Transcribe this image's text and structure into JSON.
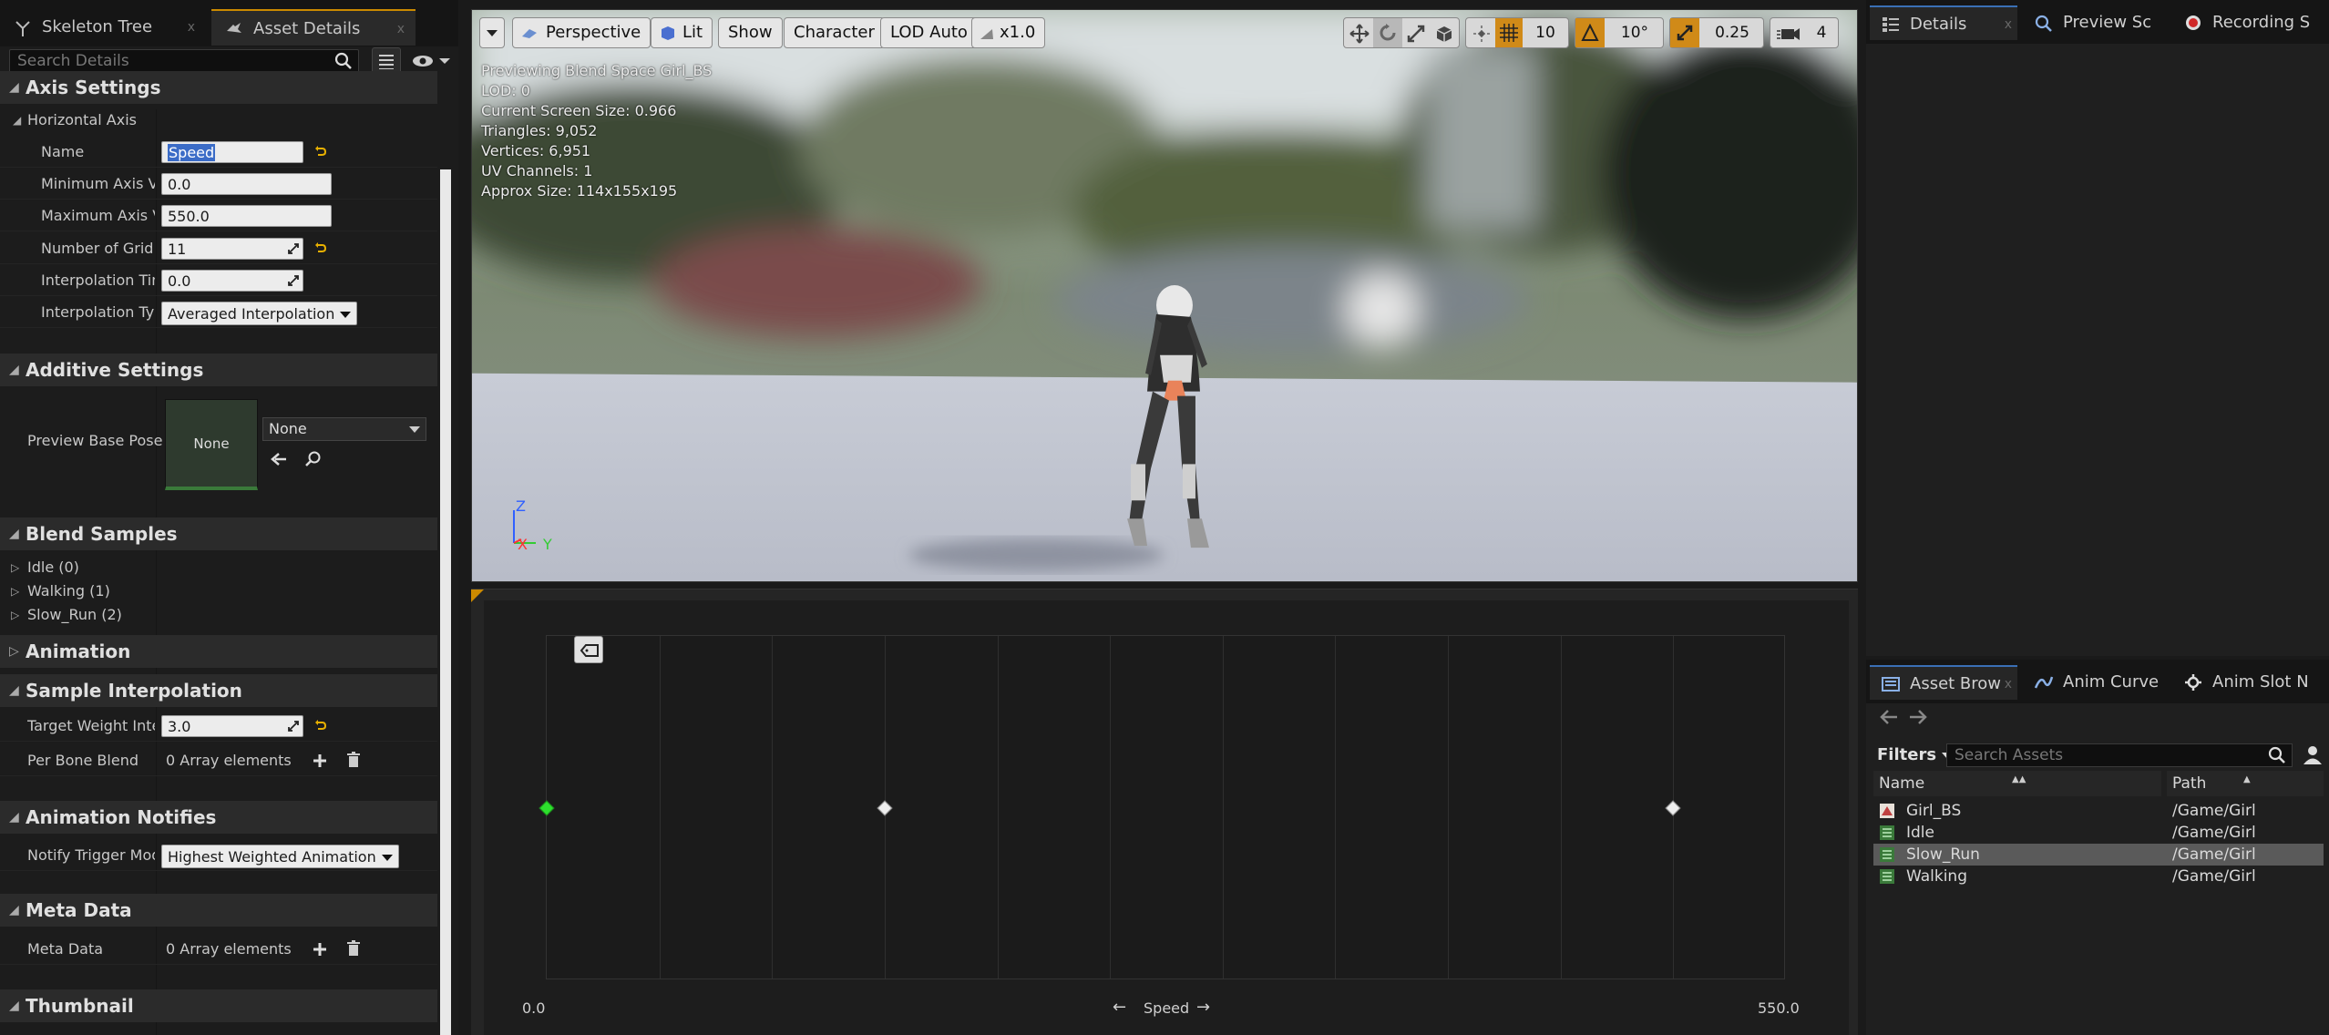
{
  "left_panel": {
    "tabs": [
      {
        "label": "Skeleton Tree",
        "icon": "skeleton-tree-icon"
      },
      {
        "label": "Asset Details",
        "icon": "asset-details-icon"
      }
    ],
    "search_placeholder": "Search Details",
    "axis_settings": {
      "title": "Axis Settings",
      "horizontal_axis": "Horizontal Axis",
      "name_label": "Name",
      "name_value": "Speed",
      "min_label": "Minimum Axis Va",
      "min_value": "0.0",
      "max_label": "Maximum Axis Va",
      "max_value": "550.0",
      "grid_label": "Number of Grid D",
      "grid_value": "11",
      "interp_time_label": "Interpolation Time",
      "interp_time_value": "0.0",
      "interp_type_label": "Interpolation Type",
      "interp_type_value": "Averaged Interpolation"
    },
    "additive_settings": {
      "title": "Additive Settings",
      "preview_label": "Preview Base Pose",
      "thumb_text": "None",
      "asset_value": "None"
    },
    "blend_samples": {
      "title": "Blend Samples",
      "items": [
        "Idle (0)",
        "Walking (1)",
        "Slow_Run (2)"
      ]
    },
    "animation": {
      "title": "Animation"
    },
    "sample_interpolation": {
      "title": "Sample Interpolation",
      "target_label": "Target Weight Interp",
      "target_value": "3.0",
      "per_bone_label": "Per Bone Blend",
      "per_bone_value": "0 Array elements"
    },
    "animation_notifies": {
      "title": "Animation Notifies",
      "trigger_label": "Notify Trigger Mode",
      "trigger_value": "Highest Weighted Animation"
    },
    "meta_data": {
      "title": "Meta Data",
      "label": "Meta Data",
      "value": "0 Array elements"
    },
    "thumbnail": {
      "title": "Thumbnail"
    }
  },
  "viewport": {
    "buttons": {
      "perspective": "Perspective",
      "lit": "Lit",
      "show": "Show",
      "character": "Character",
      "lod": "LOD Auto",
      "speed": "x1.0"
    },
    "right_controls": {
      "grid_snap": "10",
      "rot_snap": "10°",
      "scale_snap": "0.25",
      "cam_speed": "4"
    },
    "stats": [
      "Previewing Blend Space Girl_BS",
      "LOD: 0",
      "Current Screen Size: 0.966",
      "Triangles: 9,052",
      "Vertices: 6,951",
      "UV Channels: 1",
      "Approx Size: 114x155x195"
    ],
    "gizmo": {
      "z": "Z",
      "x": "X",
      "y": "Y"
    }
  },
  "blend_editor": {
    "axis_min": "0.0",
    "axis_max": "550.0",
    "axis_name": "Speed",
    "axis_left_arrow": "←",
    "axis_right_arrow": "→",
    "samples": [
      {
        "name": "Idle",
        "speed": 0,
        "active": true
      },
      {
        "name": "Walking",
        "speed": 150,
        "active": false
      },
      {
        "name": "Slow_Run",
        "speed": 500,
        "active": false
      }
    ],
    "grid_divisions": 11
  },
  "right_top": {
    "tabs": [
      {
        "label": "Details",
        "icon": "details-icon"
      },
      {
        "label": "Preview Sc",
        "icon": "preview-scene-icon"
      },
      {
        "label": "Recording S",
        "icon": "recording-icon"
      }
    ]
  },
  "asset_browser": {
    "tabs": [
      {
        "label": "Asset Brow",
        "icon": "asset-browser-icon"
      },
      {
        "label": "Anim Curve",
        "icon": "anim-curve-icon"
      },
      {
        "label": "Anim Slot N",
        "icon": "anim-slot-icon"
      }
    ],
    "filters_label": "Filters",
    "search_placeholder": "Search Assets",
    "col_name": "Name",
    "col_path": "Path",
    "rows": [
      {
        "name": "Girl_BS",
        "path": "/Game/Girl",
        "type": "blendspace"
      },
      {
        "name": "Idle",
        "path": "/Game/Girl",
        "type": "anim"
      },
      {
        "name": "Slow_Run",
        "path": "/Game/Girl",
        "type": "anim",
        "selected": true
      },
      {
        "name": "Walking",
        "path": "/Game/Girl",
        "type": "anim"
      }
    ]
  },
  "colors": {
    "accent_orange": "#d08a18",
    "active_sample": "#2de02d",
    "selection_blue": "#3b6cc7"
  }
}
